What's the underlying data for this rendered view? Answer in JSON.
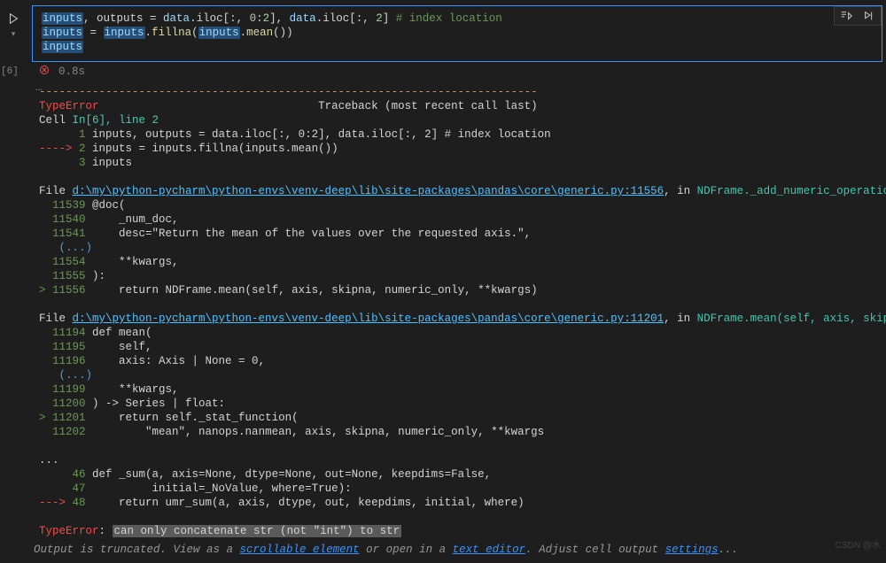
{
  "cell": {
    "exec_count": "[6]",
    "code_lines": [
      [
        {
          "t": "inputs",
          "c": "t-varhl"
        },
        {
          "t": ", outputs ",
          "c": "t-text"
        },
        {
          "t": "= ",
          "c": "t-text"
        },
        {
          "t": "data",
          "c": "t-var"
        },
        {
          "t": ".iloc[",
          "c": "t-text"
        },
        {
          "t": ":",
          "c": "t-text"
        },
        {
          "t": ", ",
          "c": "t-text"
        },
        {
          "t": "0",
          "c": "t-num"
        },
        {
          "t": ":",
          "c": "t-text"
        },
        {
          "t": "2",
          "c": "t-num"
        },
        {
          "t": "], ",
          "c": "t-text"
        },
        {
          "t": "data",
          "c": "t-var"
        },
        {
          "t": ".iloc[",
          "c": "t-text"
        },
        {
          "t": ":",
          "c": "t-text"
        },
        {
          "t": ", ",
          "c": "t-text"
        },
        {
          "t": "2",
          "c": "t-num"
        },
        {
          "t": "] ",
          "c": "t-text"
        },
        {
          "t": "# index location",
          "c": "t-comment"
        }
      ],
      [
        {
          "t": "inputs",
          "c": "t-varhl"
        },
        {
          "t": " = ",
          "c": "t-text"
        },
        {
          "t": "inputs",
          "c": "t-varhl"
        },
        {
          "t": ".",
          "c": "t-text"
        },
        {
          "t": "fillna",
          "c": "t-func"
        },
        {
          "t": "(",
          "c": "t-text"
        },
        {
          "t": "inputs",
          "c": "t-varhl"
        },
        {
          "t": ".",
          "c": "t-text"
        },
        {
          "t": "mean",
          "c": "t-func"
        },
        {
          "t": "())",
          "c": "t-text"
        }
      ],
      [
        {
          "t": "inputs",
          "c": "t-varhl"
        }
      ]
    ],
    "status_time": "0.8s"
  },
  "output": {
    "dash_line": "---------------------------------------------------------------------------",
    "error_name": "TypeError",
    "traceback_label": "Traceback (most recent call last)",
    "cell_ref": "Cell ",
    "in_label": "In[6], line 2",
    "lines_ctx": [
      {
        "ln": "1",
        "arrow": "      ",
        "txt": "inputs, outputs = data.iloc[:, 0:2], data.iloc[:, 2] # index location"
      },
      {
        "ln": "2",
        "arrow": "----> ",
        "txt": "inputs = inputs.fillna(inputs.mean())"
      },
      {
        "ln": "3",
        "arrow": "      ",
        "txt": "inputs"
      }
    ],
    "frames": [
      {
        "file_prefix": "File ",
        "path": "d:\\my\\python-pycharm\\python-envs\\venv-deep\\lib\\site-packages\\pandas\\core\\generic.py:11556",
        "in_label": ", in ",
        "sig": "NDFrame._add_numeric_operations..mean(self, ",
        "body": [
          {
            "ln": "11539",
            "pre": "  ",
            "txt": "@doc("
          },
          {
            "ln": "11540",
            "pre": "  ",
            "txt": "    _num_doc,"
          },
          {
            "ln": "11541",
            "pre": "  ",
            "txt": "    desc=\"Return the mean of the values over the requested axis.\","
          },
          {
            "ln": "(...)",
            "pre": "   ",
            "txt": ""
          },
          {
            "ln": "11554",
            "pre": "  ",
            "txt": "    **kwargs,"
          },
          {
            "ln": "11555",
            "pre": "  ",
            "txt": "):"
          },
          {
            "ln": "11556",
            "pre": "> ",
            "txt": "    return NDFrame.mean(self, axis, skipna, numeric_only, **kwargs)"
          }
        ]
      },
      {
        "file_prefix": "File ",
        "path": "d:\\my\\python-pycharm\\python-envs\\venv-deep\\lib\\site-packages\\pandas\\core\\generic.py:11201",
        "in_label": ", in ",
        "sig": "NDFrame.mean(self, axis, skipna, numeric_onl",
        "body": [
          {
            "ln": "11194",
            "pre": "  ",
            "txt": "def mean("
          },
          {
            "ln": "11195",
            "pre": "  ",
            "txt": "    self,"
          },
          {
            "ln": "11196",
            "pre": "  ",
            "txt": "    axis: Axis | None = 0,"
          },
          {
            "ln": "(...)",
            "pre": "   ",
            "txt": ""
          },
          {
            "ln": "11199",
            "pre": "  ",
            "txt": "    **kwargs,"
          },
          {
            "ln": "11200",
            "pre": "  ",
            "txt": ") -> Series | float:"
          },
          {
            "ln": "11201",
            "pre": "> ",
            "txt": "    return self._stat_function("
          },
          {
            "ln": "11202",
            "pre": "  ",
            "txt": "        \"mean\", nanops.nanmean, axis, skipna, numeric_only, **kwargs"
          }
        ]
      }
    ],
    "ellipsis": "...",
    "tail_lines": [
      {
        "ln": "46",
        "arrow": "     ",
        "txt": "def _sum(a, axis=None, dtype=None, out=None, keepdims=False,"
      },
      {
        "ln": "47",
        "arrow": "     ",
        "txt": "         initial=_NoValue, where=True):"
      },
      {
        "ln": "48",
        "arrow": "---> ",
        "txt": "    return umr_sum(a, axis, dtype, out, keepdims, initial, where)"
      }
    ],
    "final_error": "TypeError",
    "final_msg": "can only concatenate str (not \"int\") to str"
  },
  "trunc": {
    "pre": "Output is truncated. View as a ",
    "link1": "scrollable element",
    "mid": " or open in a ",
    "link2": "text editor",
    "post": ". Adjust cell output ",
    "link3": "settings",
    "end": "..."
  },
  "watermark": "CSDN @水"
}
